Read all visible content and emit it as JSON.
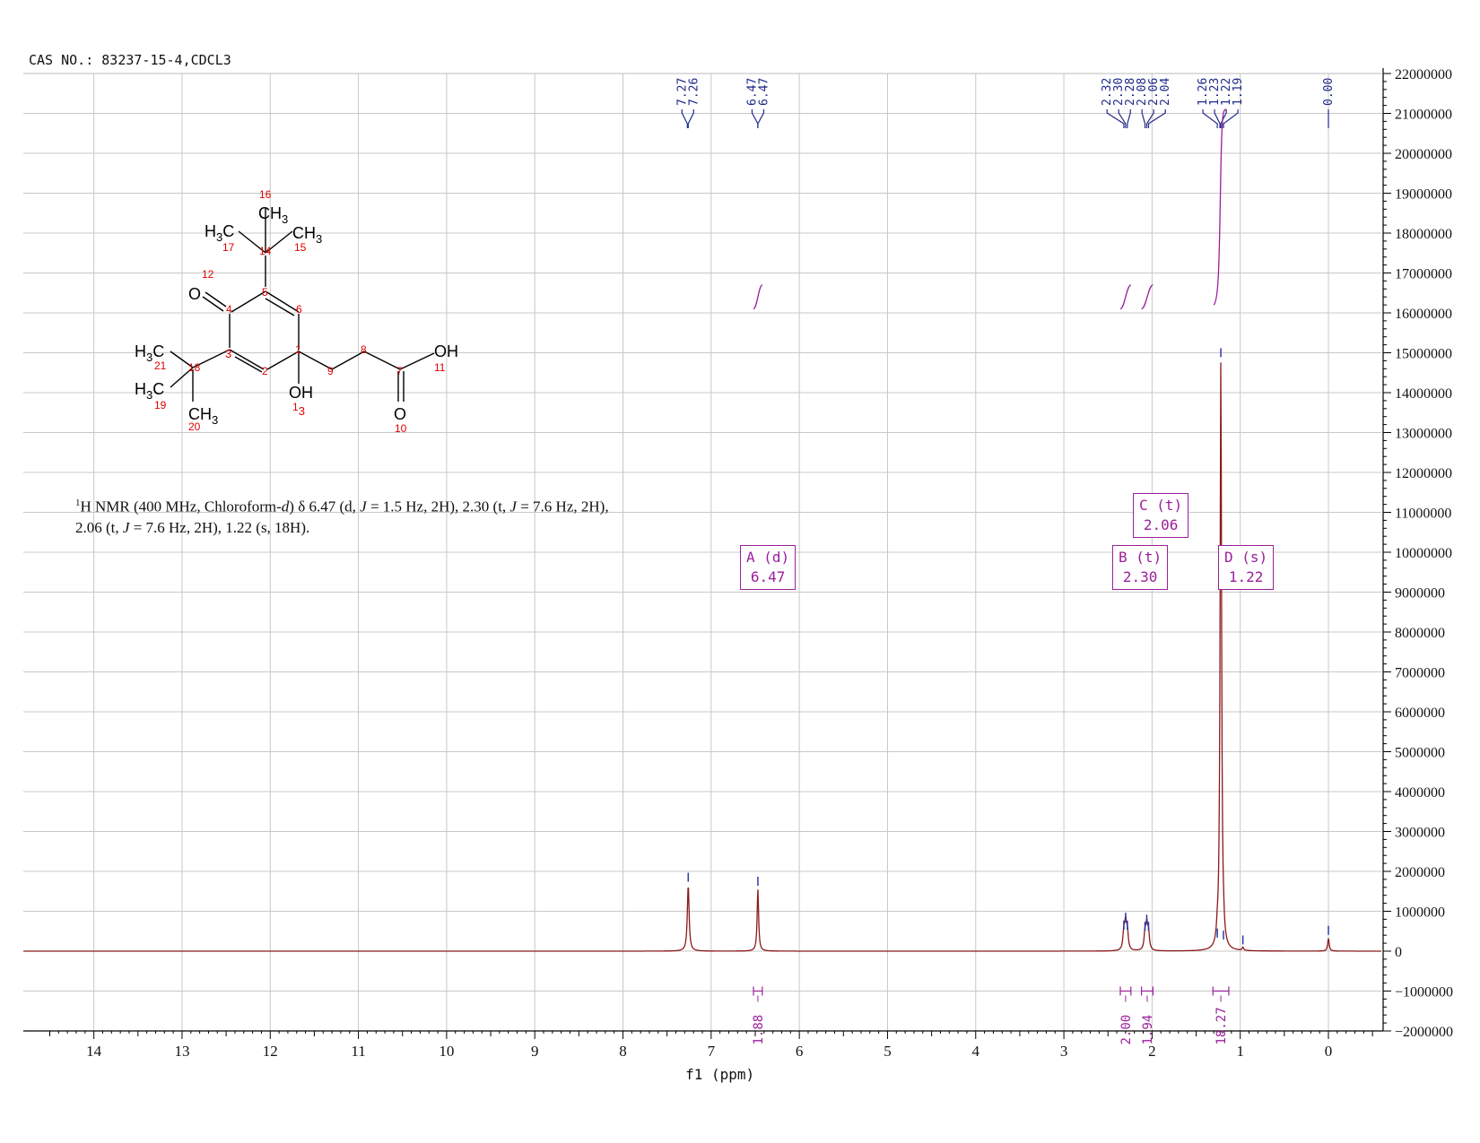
{
  "header": {
    "title": "CAS NO.: 83237-15-4,CDCL3"
  },
  "summary": {
    "nucleus_sup": "1",
    "lead": "H NMR (400 MHz, Chloroform-",
    "solvent_d": "d",
    "seg1": ") δ 6.47 (d, ",
    "J1": "J",
    "seg2": " = 1.5 Hz, 2H), 2.30 (t, ",
    "J2": "J",
    "seg3": " = 7.6 Hz, 2H),",
    "seg4": "2.06 (t, ",
    "J3": "J",
    "seg5": " = 7.6 Hz, 2H), 1.22 (s, 18H)."
  },
  "chart_data": {
    "type": "line",
    "xlabel": "f1 (ppm)",
    "xlim": [
      14.8,
      -0.6
    ],
    "ylim": [
      -2000000,
      22000000
    ],
    "x_ticks": [
      14,
      13,
      12,
      11,
      10,
      9,
      8,
      7,
      6,
      5,
      4,
      3,
      2,
      1,
      0
    ],
    "y_ticks": [
      22000000,
      21000000,
      20000000,
      19000000,
      18000000,
      17000000,
      16000000,
      15000000,
      14000000,
      13000000,
      12000000,
      11000000,
      10000000,
      9000000,
      8000000,
      7000000,
      6000000,
      5000000,
      4000000,
      3000000,
      2000000,
      1000000,
      0,
      -1000000,
      -2000000
    ],
    "y_tick_labels": [
      "22000000",
      "21000000",
      "20000000",
      "19000000",
      "18000000",
      "17000000",
      "16000000",
      "15000000",
      "14000000",
      "13000000",
      "12000000",
      "11000000",
      "10000000",
      "9000000",
      "8000000",
      "7000000",
      "6000000",
      "5000000",
      "4000000",
      "3000000",
      "2000000",
      "1000000",
      "0",
      "−1000000",
      "−2000000"
    ],
    "grid": true,
    "spectrum_color": "#8b1a1a",
    "peaks": [
      {
        "ppm": 7.26,
        "height": 1650000,
        "width": 0.012
      },
      {
        "ppm": 6.47,
        "height": 1550000,
        "width": 0.01
      },
      {
        "ppm": 2.32,
        "height": 450000,
        "width": 0.012
      },
      {
        "ppm": 2.3,
        "height": 650000,
        "width": 0.012
      },
      {
        "ppm": 2.28,
        "height": 450000,
        "width": 0.012
      },
      {
        "ppm": 2.08,
        "height": 420000,
        "width": 0.012
      },
      {
        "ppm": 2.06,
        "height": 600000,
        "width": 0.012
      },
      {
        "ppm": 2.04,
        "height": 420000,
        "width": 0.012
      },
      {
        "ppm": 1.26,
        "height": 250000,
        "width": 0.01
      },
      {
        "ppm": 1.22,
        "height": 14800000,
        "width": 0.01
      },
      {
        "ppm": 1.19,
        "height": 200000,
        "width": 0.01
      },
      {
        "ppm": 0.97,
        "height": 80000,
        "width": 0.01
      },
      {
        "ppm": 0.0,
        "height": 320000,
        "width": 0.01
      }
    ],
    "peak_labels": [
      {
        "group": [
          7.27,
          7.26
        ],
        "labels": [
          "7.27",
          "7.26"
        ],
        "anchor": 7.265
      },
      {
        "group": [
          6.47,
          6.47
        ],
        "labels": [
          "6.47",
          "6.47"
        ],
        "anchor": 6.47
      },
      {
        "group": [
          2.32,
          2.3,
          2.28,
          2.08,
          2.06,
          2.04
        ],
        "labels": [
          "2.32",
          "2.30",
          "2.28",
          "2.08",
          "2.06",
          "2.04"
        ],
        "anchor": 2.18
      },
      {
        "group": [
          1.26,
          1.23,
          1.22,
          1.19
        ],
        "labels": [
          "1.26",
          "1.23",
          "1.22",
          "1.19"
        ],
        "anchor": 1.225
      },
      {
        "group": [
          0.0
        ],
        "labels": [
          "0.00"
        ],
        "anchor": 0.0
      }
    ],
    "integrals": [
      {
        "from": 6.52,
        "to": 6.42,
        "value": "1.88"
      },
      {
        "from": 2.36,
        "to": 2.24,
        "value": "2.00"
      },
      {
        "from": 2.12,
        "to": 1.99,
        "value": "1.94"
      },
      {
        "from": 1.31,
        "to": 1.13,
        "value": "18.27"
      }
    ],
    "multiplets": [
      {
        "name": "A (d)",
        "shift": "6.47",
        "ppm": 6.47
      },
      {
        "name": "B (t)",
        "shift": "2.30",
        "ppm": 2.3
      },
      {
        "name": "C (t)",
        "shift": "2.06",
        "ppm": 2.06
      },
      {
        "name": "D (s)",
        "shift": "1.22",
        "ppm": 1.22
      }
    ],
    "colors": {
      "peak_label": "#1f2a8a",
      "integral": "#9b1f9b",
      "spectrum": "#8b1a1a",
      "grid": "#c8c8c8"
    }
  },
  "structure": {
    "atoms": {
      "ch3_16": "CH3",
      "h3c_17": "H3C",
      "ch3_15": "CH3",
      "o_12": "O",
      "h3c_21": "H3C",
      "h3c_19": "H3C",
      "ch3_20": "CH3",
      "oh_13": "OH",
      "oh_11": "OH",
      "o_10": "O"
    },
    "numbers": [
      "16",
      "17",
      "14",
      "15",
      "12",
      "5",
      "4",
      "6",
      "3",
      "1",
      "21",
      "18",
      "2",
      "9",
      "8",
      "7",
      "11",
      "19",
      "20",
      "13",
      "10"
    ]
  }
}
